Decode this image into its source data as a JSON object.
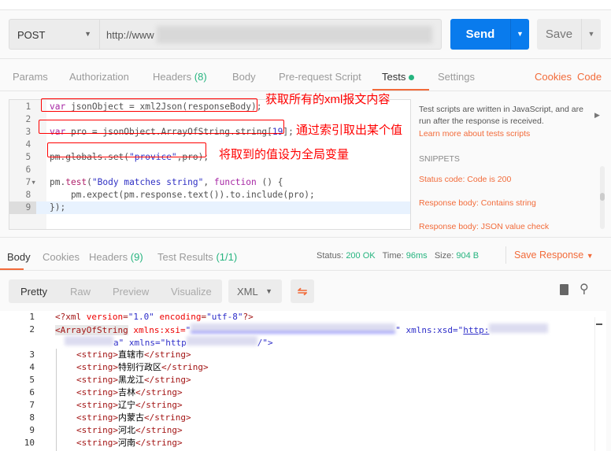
{
  "request": {
    "method": "POST",
    "url": "http://www",
    "send": "Send",
    "save": "Save"
  },
  "req_tabs": [
    {
      "label": "Params"
    },
    {
      "label": "Authorization"
    },
    {
      "label": "Headers",
      "count": "(8)"
    },
    {
      "label": "Body"
    },
    {
      "label": "Pre-request Script"
    },
    {
      "label": "Tests"
    },
    {
      "label": "Settings"
    }
  ],
  "req_links": {
    "cookies": "Cookies",
    "code": "Code"
  },
  "editor_lines": [
    [
      [
        "var",
        "kw"
      ],
      " jsonObject = xml2Json(responseBody);"
    ],
    [],
    [
      [
        "var",
        "kw"
      ],
      " pro = jsonObject.ArrayOfString.string[",
      [
        "19",
        "nm"
      ],
      "];"
    ],
    [],
    [
      "pm.globals.set(",
      [
        "\"provice\"",
        "st"
      ],
      ",pro);"
    ],
    [],
    [
      "pm.",
      [
        "test",
        "fn"
      ],
      "(",
      [
        "\"Body matches string\"",
        "st"
      ],
      ", ",
      [
        "function",
        "kw"
      ],
      " () {"
    ],
    [
      "    pm.expect(pm.response.text()).to.include(pro);"
    ],
    [
      "});"
    ]
  ],
  "annotations": [
    "获取所有的xml报文内容",
    "通过索引取出某个值",
    "将取到的值设为全局变量"
  ],
  "side": {
    "desc": "Test scripts are written in JavaScript, and are run after the response is received.",
    "learn": "Learn more about tests scripts",
    "snippets_title": "SNIPPETS",
    "snippets": [
      "Status code: Code is 200",
      "Response body: Contains string",
      "Response body: JSON value check"
    ]
  },
  "resp_tabs": [
    {
      "label": "Body"
    },
    {
      "label": "Cookies"
    },
    {
      "label": "Headers",
      "count": "(9)"
    },
    {
      "label": "Test Results",
      "count": "(1/1)"
    }
  ],
  "status": {
    "status_label": "Status:",
    "status": "200 OK",
    "time_label": "Time:",
    "time": "96ms",
    "size_label": "Size:",
    "size": "904 B",
    "save_response": "Save Response"
  },
  "view_modes": [
    "Pretty",
    "Raw",
    "Preview",
    "Visualize"
  ],
  "format": "XML",
  "xml": {
    "decl": [
      "<?xml ",
      "version",
      "=",
      "\"1.0\"",
      " ",
      "encoding",
      "=",
      "\"utf-8\"",
      "?>"
    ],
    "root_open": "<ArrayOfString",
    "xsi": " xmlns:xsi=",
    "xsd": "\" xmlns:xsd=\"",
    "xsd_val": "http:",
    "wrap_tail": "a\" xmlns=\"",
    "wrap_val": "http",
    "wrap_end": "/\">",
    "items": [
      "直辖市",
      "特别行政区",
      "黑龙江",
      "吉林",
      "辽宁",
      "内蒙古",
      "河北",
      "河南"
    ]
  }
}
